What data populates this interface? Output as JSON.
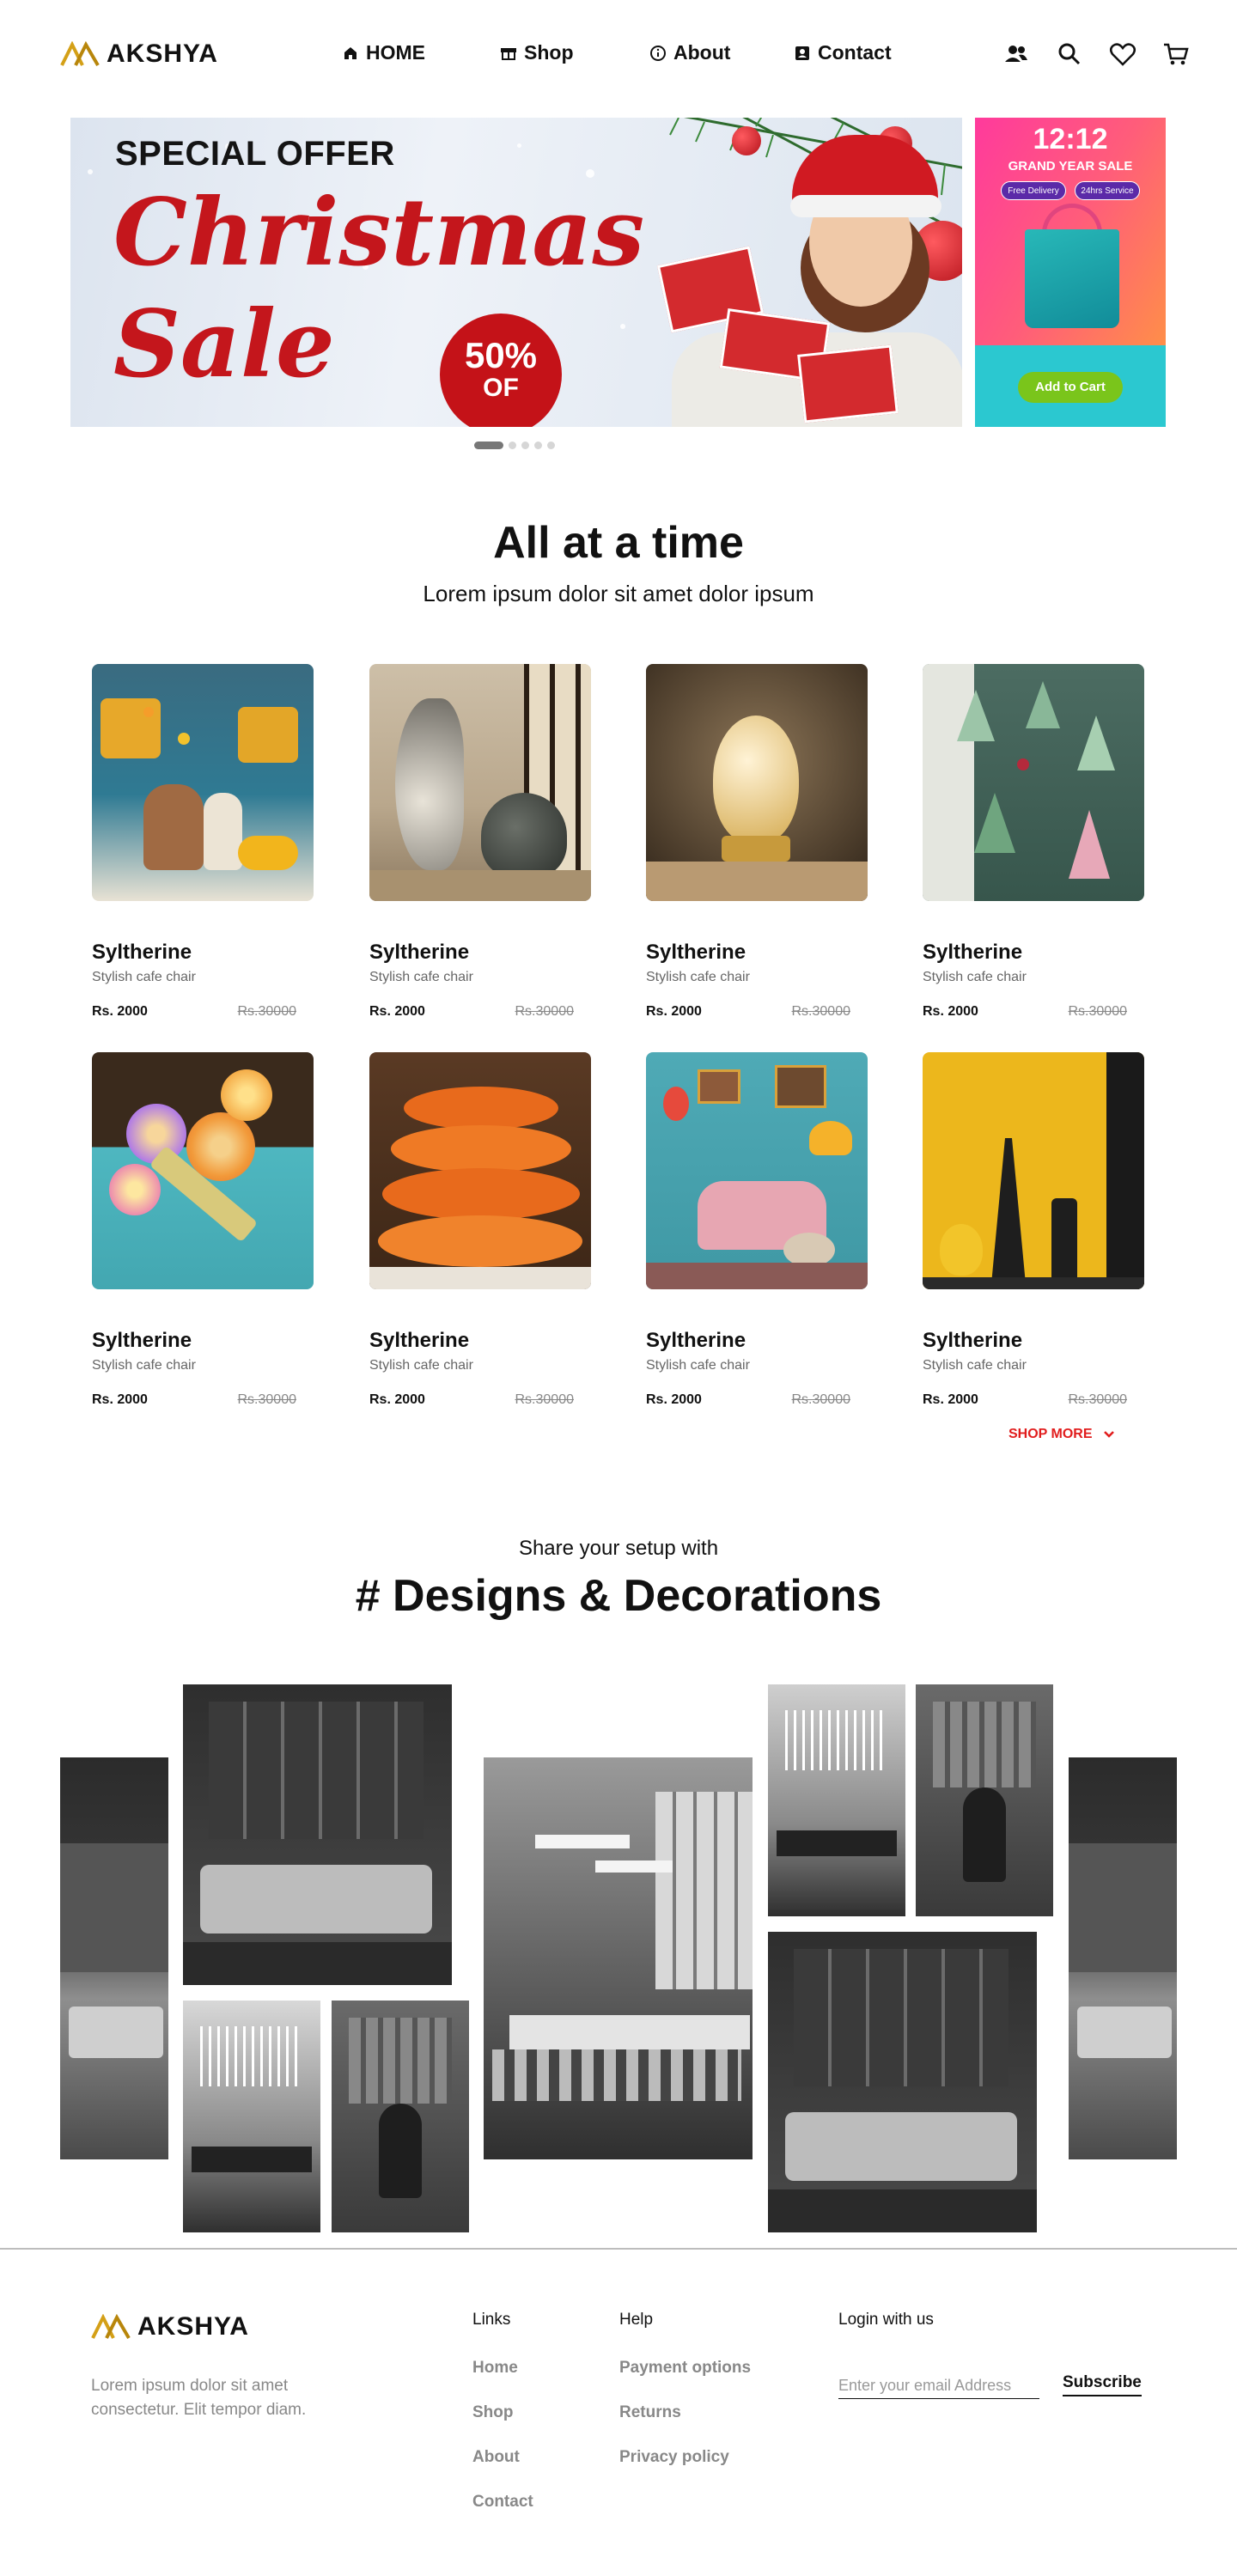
{
  "header": {
    "logo_text": "AKSHYA",
    "nav": [
      {
        "label": "HOME",
        "icon": "home-icon"
      },
      {
        "label": "Shop",
        "icon": "gift-icon"
      },
      {
        "label": "About",
        "icon": "info-icon"
      },
      {
        "label": "Contact",
        "icon": "contact-icon"
      }
    ],
    "icons": [
      "users-icon",
      "search-icon",
      "heart-icon",
      "cart-icon"
    ]
  },
  "hero": {
    "offer": "SPECIAL OFFER",
    "title_line1": "Christmas",
    "title_line2": "Sale",
    "badge_pct": "50%",
    "badge_of": "OF",
    "side": {
      "time": "12:12",
      "sale": "GRAND YEAR SALE",
      "chip1": "Free Delivery",
      "chip2": "24hrs Service",
      "cta": "Add to Cart"
    },
    "slides": 5,
    "active_slide": 1
  },
  "section1": {
    "title": "All at a time",
    "subtitle": "Lorem ipsum dolor sit amet dolor ipsum",
    "products": [
      {
        "name": "Syltherine",
        "desc": "Stylish cafe chair",
        "price": "Rs. 2000",
        "old_price": "Rs.30000"
      },
      {
        "name": "Syltherine",
        "desc": "Stylish cafe chair",
        "price": "Rs. 2000",
        "old_price": "Rs.30000"
      },
      {
        "name": "Syltherine",
        "desc": "Stylish cafe chair",
        "price": "Rs. 2000",
        "old_price": "Rs.30000"
      },
      {
        "name": "Syltherine",
        "desc": "Stylish cafe chair",
        "price": "Rs. 2000",
        "old_price": "Rs.30000"
      },
      {
        "name": "Syltherine",
        "desc": "Stylish cafe chair",
        "price": "Rs. 2000",
        "old_price": "Rs.30000"
      },
      {
        "name": "Syltherine",
        "desc": "Stylish cafe chair",
        "price": "Rs. 2000",
        "old_price": "Rs.30000"
      },
      {
        "name": "Syltherine",
        "desc": "Stylish cafe chair",
        "price": "Rs. 2000",
        "old_price": "Rs.30000"
      },
      {
        "name": "Syltherine",
        "desc": "Stylish cafe chair",
        "price": "Rs. 2000",
        "old_price": "Rs.30000"
      }
    ],
    "shop_more": "SHOP MORE"
  },
  "section2": {
    "subtitle": "Share your setup with",
    "title": "# Designs & Decorations"
  },
  "footer": {
    "logo_text": "AKSHYA",
    "desc": "Lorem ipsum dolor sit amet consectetur. Elit tempor diam.",
    "links_heading": "Links",
    "links": [
      "Home",
      "Shop",
      "About",
      "Contact"
    ],
    "help_heading": "Help",
    "help": [
      "Payment options",
      "Returns",
      "Privacy policy"
    ],
    "login_heading": "Login with us",
    "email_placeholder": "Enter your email Address",
    "subscribe": "Subscribe"
  },
  "colors": {
    "accent_red": "#e11d1d",
    "hero_red": "#c4161c",
    "logo_gold": "#d4a017",
    "cta_green": "#7ac51b"
  }
}
